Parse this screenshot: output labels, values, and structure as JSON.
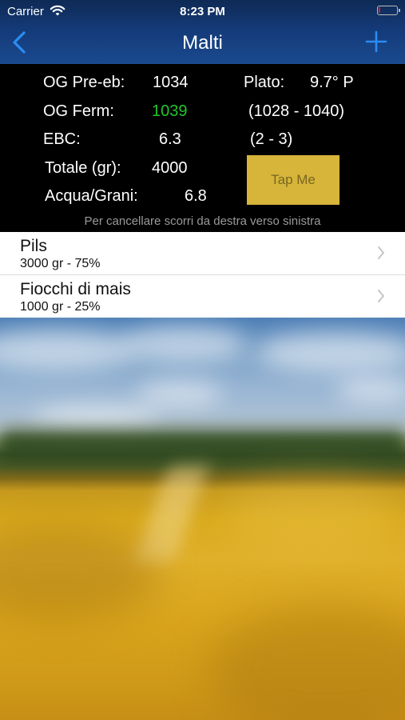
{
  "status_bar": {
    "carrier": "Carrier",
    "time": "8:23 PM",
    "battery_level": 0.1,
    "battery_color": "#e02020"
  },
  "nav": {
    "title": "Malti",
    "back_icon": "chevron-left-icon",
    "add_icon": "plus-icon",
    "accent_color": "#2a8df4"
  },
  "summary": {
    "og_pre_label": "OG Pre-eb:",
    "og_pre_value": "1034",
    "plato_label": "Plato:",
    "plato_value": "9.7° P",
    "og_ferm_label": "OG Ferm:",
    "og_ferm_value": "1039",
    "og_ferm_range": "(1028 - 1040)",
    "ebc_label": "EBC:",
    "ebc_value": "6.3",
    "ebc_range": "(2 - 3)",
    "totale_label": "Totale (gr):",
    "totale_value": "4000",
    "acqua_label": "Acqua/Grani:",
    "acqua_value": "6.8",
    "tap_button": "Tap Me",
    "hint": "Per cancellare scorri da destra verso sinistra"
  },
  "malts": [
    {
      "name": "Pils",
      "detail": "3000 gr - 75%"
    },
    {
      "name": "Fiocchi di mais",
      "detail": "1000 gr - 25%"
    }
  ]
}
